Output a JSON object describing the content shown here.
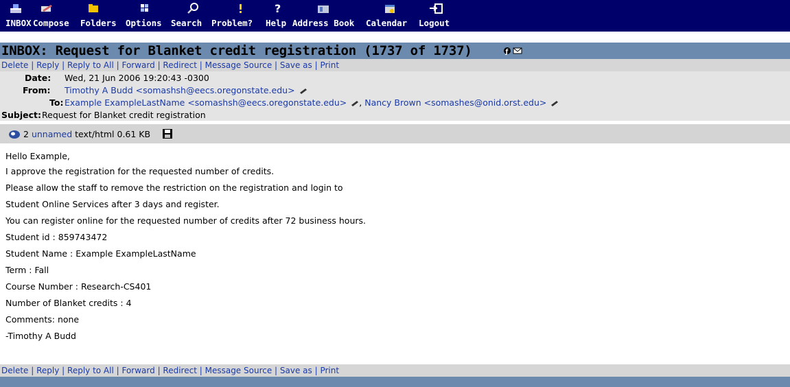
{
  "nav": [
    {
      "label": "INBOX",
      "icon": "inbox-icon"
    },
    {
      "label": "Compose",
      "icon": "compose-icon"
    },
    {
      "label": "Folders",
      "icon": "folders-icon"
    },
    {
      "label": "Options",
      "icon": "options-icon"
    },
    {
      "label": "Search",
      "icon": "search-icon"
    },
    {
      "label": "Problem?",
      "icon": "problem-icon"
    },
    {
      "label": "Help",
      "icon": "help-icon"
    },
    {
      "label": "Address Book",
      "icon": "address-book-icon"
    },
    {
      "label": "Calendar",
      "icon": "calendar-icon"
    },
    {
      "label": "Logout",
      "icon": "logout-icon"
    }
  ],
  "title": "INBOX: Request for Blanket credit registration (1737 of 1737)",
  "actions": [
    "Delete",
    "Reply",
    "Reply to All",
    "Forward",
    "Redirect",
    "Message Source",
    "Save as",
    "Print"
  ],
  "headers": {
    "date_label": "Date:",
    "date_value": "Wed, 21 Jun 2006 19:20:43 -0300",
    "from_label": "From:",
    "from_value": "Timothy A Budd <somashsh@eecs.oregonstate.edu>",
    "to_label": "To:",
    "to_value_1": "Example ExampleLastName <somashsh@eecs.oregonstate.edu>",
    "to_sep": ",",
    "to_value_2": "Nancy Brown <somashes@onid.orst.edu>",
    "subject_label": "Subject:",
    "subject_value": "Request for Blanket credit registration"
  },
  "attachment": {
    "number": "2",
    "name": "unnamed",
    "type": "text/html",
    "size": "0.61 KB"
  },
  "body_lines": [
    "Hello Example,",
    "I approve the registration for the requested number of credits.",
    "Please allow the staff to remove the restriction on the registration and login to",
    "Student Online Services after 3 days and register.",
    "You can register online for the requested number of credits after 72 business hours.",
    "Student id : 859743472",
    "Student Name : Example ExampleLastName",
    "Term : Fall",
    "Course Number : Research-CS401",
    "Number of Blanket credits : 4",
    "Comments: none",
    "-Timothy A Budd"
  ],
  "colors": {
    "nav_bg": "#00006b",
    "title_bg": "#6b8aad",
    "action_bg": "#d6d6d6",
    "link": "#1a3aa8"
  }
}
